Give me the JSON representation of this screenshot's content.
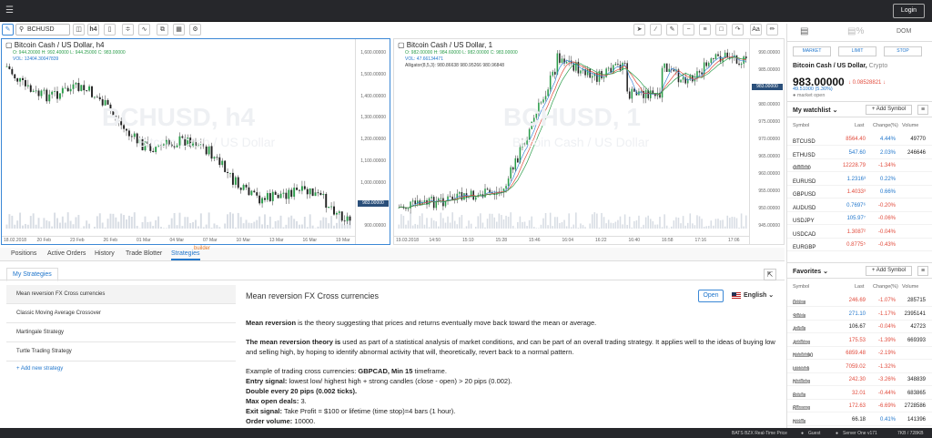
{
  "topbar": {
    "login_label": "Login"
  },
  "toolbar": {
    "symbol": "BCHUSD",
    "interval": "h4"
  },
  "left_chart": {
    "title": "Bitcoin Cash / US Dollar, h4",
    "ohlc": "O: 944.20000  H: 992.40000  L: 944.25000  C: 983.00000",
    "vol": "VOL: 12404.30047839",
    "watermark": "BCHUSD, h4",
    "watermark_sub": "Bitcoin Cash / US Dollar",
    "price_ticks": [
      "1,600.00000",
      "1,500.00000",
      "1,400.00000",
      "1,300.00000",
      "1,200.00000",
      "1,100.00000",
      "1,000.00000",
      "983.00000",
      "900.00000"
    ],
    "time_ticks": [
      "18.02.2018",
      "20 Feb",
      "23 Feb",
      "26 Feb",
      "01 Mar",
      "04 Mar",
      "07 Mar",
      "10 Mar",
      "13 Mar",
      "16 Mar",
      "19 Mar"
    ]
  },
  "right_chart": {
    "title": "Bitcoin Cash / US Dollar, 1",
    "ohlc": "O: 982.00000  H: 984.60000  L: 982.00000  C: 983.00000",
    "vol": "VOL: 47.66134471",
    "alligator": "Alligator(8,5,3): 980.86638  980.95266  980.96848",
    "watermark": "BCHUSD, 1",
    "watermark_sub": "Bitcoin Cash / US Dollar",
    "price_ticks": [
      "990.00000",
      "985.00000",
      "983.00000",
      "980.00000",
      "975.00000",
      "970.00000",
      "965.00000",
      "960.00000",
      "955.00000",
      "950.00000",
      "945.00000"
    ],
    "time_ticks": [
      "19.03.2018",
      "14:50",
      "15:10",
      "15:28",
      "15:46",
      "16:04",
      "16:22",
      "16:40",
      "16:58",
      "17:16",
      "17:06"
    ]
  },
  "bottom_tabs": [
    "Positions",
    "Active Orders",
    "History",
    "Trade Blotter",
    "Strategies"
  ],
  "builder_badge": "builder",
  "strategies": {
    "tab_label": "My Strategies",
    "items": [
      "Mean reversion FX Cross currencies",
      "Classic Moving Average Crossover",
      "Martingale Strategy",
      "Turtle Trading Strategy"
    ],
    "add_label": "+ Add new strategy",
    "open_label": "Open",
    "language": "English",
    "desc_title": "Mean reversion FX Cross currencies",
    "p1_b": "Mean reversion",
    "p1": " is the theory suggesting that prices and returns eventually move back toward the mean or average.",
    "p2_b": "The mean reversion theory is",
    "p2": " used as part of a statistical analysis of market conditions, and can be part of an overall trading strategy. It applies well to the ideas of buying low and selling high, by hoping to identify abnormal activity that will, theoretically, revert back to a normal pattern.",
    "ex": "Example of trading cross currencies: ",
    "ex_b": "GBPCAD, Min 15",
    "ex2": " timeframe.",
    "entry_b": "Entry signal:",
    "entry": " lowest low/ highest high + strong candles (close - open) > 20 pips (0.002).",
    "double_b": "Double every 20 pips (0.002 ticks).",
    "maxdeals_b": "Max open deals:",
    "maxdeals": " 3.",
    "exit_b": "Exit signal:",
    "exit": " Take Profit = $100 or lifetime (time stop)=4 bars (1 hour).",
    "vol_b": "Order volume:",
    "vol": " 10000."
  },
  "sidebar": {
    "order_tabs": [
      "MARKET",
      "LIMIT",
      "STOP"
    ],
    "dom_label": "DOM",
    "symbol_name": "Bitcoin Cash / US Dollar,",
    "symbol_type": "Crypto",
    "price": "983.00000",
    "change": "↓ 0.08528821 ↓",
    "low": "49.51000 (5.30%)",
    "state": "● market open",
    "watchlist_title": "My watchlist ⌄",
    "favorites_title": "Favorites ⌄",
    "add_symbol": "+ Add Symbol",
    "columns": [
      "Symbol",
      "Last",
      "Change(%)",
      "Volume"
    ],
    "watchlist": [
      {
        "sym": "BTCUSD",
        "tag": "",
        "last": "8564.40",
        "chg": "4.44%",
        "vol": "49770",
        "dir": "dn",
        "cdir": "up"
      },
      {
        "sym": "ETHUSD",
        "tag": "",
        "last": "547.60",
        "chg": "2.03%",
        "vol": "246646",
        "dir": "up",
        "cdir": "up"
      },
      {
        "sym": "GER30",
        "tag": "GLOBAL",
        "last": "12228.79",
        "chg": "-1.34%",
        "vol": "",
        "dir": "dn",
        "cdir": "dn"
      },
      {
        "sym": "EURUSD",
        "tag": "",
        "last": "1.2316³",
        "chg": "0.22%",
        "vol": "",
        "dir": "up",
        "cdir": "up"
      },
      {
        "sym": "GBPUSD",
        "tag": "",
        "last": "1.4033³",
        "chg": "0.66%",
        "vol": "",
        "dir": "dn",
        "cdir": "up"
      },
      {
        "sym": "AUDUSD",
        "tag": "",
        "last": "0.7697⁶",
        "chg": "-0.20%",
        "vol": "",
        "dir": "up",
        "cdir": "dn"
      },
      {
        "sym": "USDJPY",
        "tag": "",
        "last": "105.97⁷",
        "chg": "-0.06%",
        "vol": "",
        "dir": "up",
        "cdir": "dn"
      },
      {
        "sym": "USDCAD",
        "tag": "",
        "last": "1.3087²",
        "chg": "-0.04%",
        "vol": "",
        "dir": "dn",
        "cdir": "dn"
      },
      {
        "sym": "EURGBP",
        "tag": "",
        "last": "0.8775⁵",
        "chg": "-0.43%",
        "vol": "",
        "dir": "dn",
        "cdir": "dn"
      }
    ],
    "favorites": [
      {
        "sym": "DIA",
        "tag": "NYSE",
        "last": "246.69",
        "chg": "-1.07%",
        "vol": "285715",
        "dir": "dn",
        "cdir": "dn"
      },
      {
        "sym": "SPY",
        "tag": "NYSE",
        "last": "271.10",
        "chg": "-1.17%",
        "vol": "2395141",
        "dir": "up",
        "cdir": "dn"
      },
      {
        "sym": "AGG",
        "tag": "NYSE",
        "last": "106.67",
        "chg": "-0.04%",
        "vol": "42723",
        "dir": "neu",
        "cdir": "dn"
      },
      {
        "sym": "AAPL",
        "tag": "NASDAQ",
        "last": "175.53",
        "chg": "-1.39%",
        "vol": "669393",
        "dir": "dn",
        "cdir": "dn"
      },
      {
        "sym": "NAS100",
        "tag": "GLOBAL",
        "last": "6859.48",
        "chg": "-2.19%",
        "vol": "",
        "dir": "dn",
        "cdir": "dn"
      },
      {
        "sym": "UK100",
        "tag": "GLOBAL",
        "last": "7059.02",
        "chg": "-1.32%",
        "vol": "",
        "dir": "dn",
        "cdir": "dn"
      },
      {
        "sym": "NVDA",
        "tag": "NASDAQ",
        "last": "242.30",
        "chg": "-3.26%",
        "vol": "348839",
        "dir": "dn",
        "cdir": "dn"
      },
      {
        "sym": "BAC",
        "tag": "NYSE",
        "last": "32.01",
        "chg": "-0.44%",
        "vol": "683865",
        "dir": "dn",
        "cdir": "dn"
      },
      {
        "sym": "FB",
        "tag": "NASDAQ",
        "last": "172.63",
        "chg": "-6.69%",
        "vol": "2728586",
        "dir": "dn",
        "cdir": "dn"
      },
      {
        "sym": "NKE",
        "tag": "NYSE",
        "last": "66.18",
        "chg": "0.41%",
        "vol": "141396",
        "dir": "neu",
        "cdir": "up"
      }
    ]
  },
  "statusbar": {
    "feed": "BATS BZX Real-Time Price",
    "user": "Guest",
    "server": "Server One v171",
    "traffic": "7KB / 728KB"
  }
}
